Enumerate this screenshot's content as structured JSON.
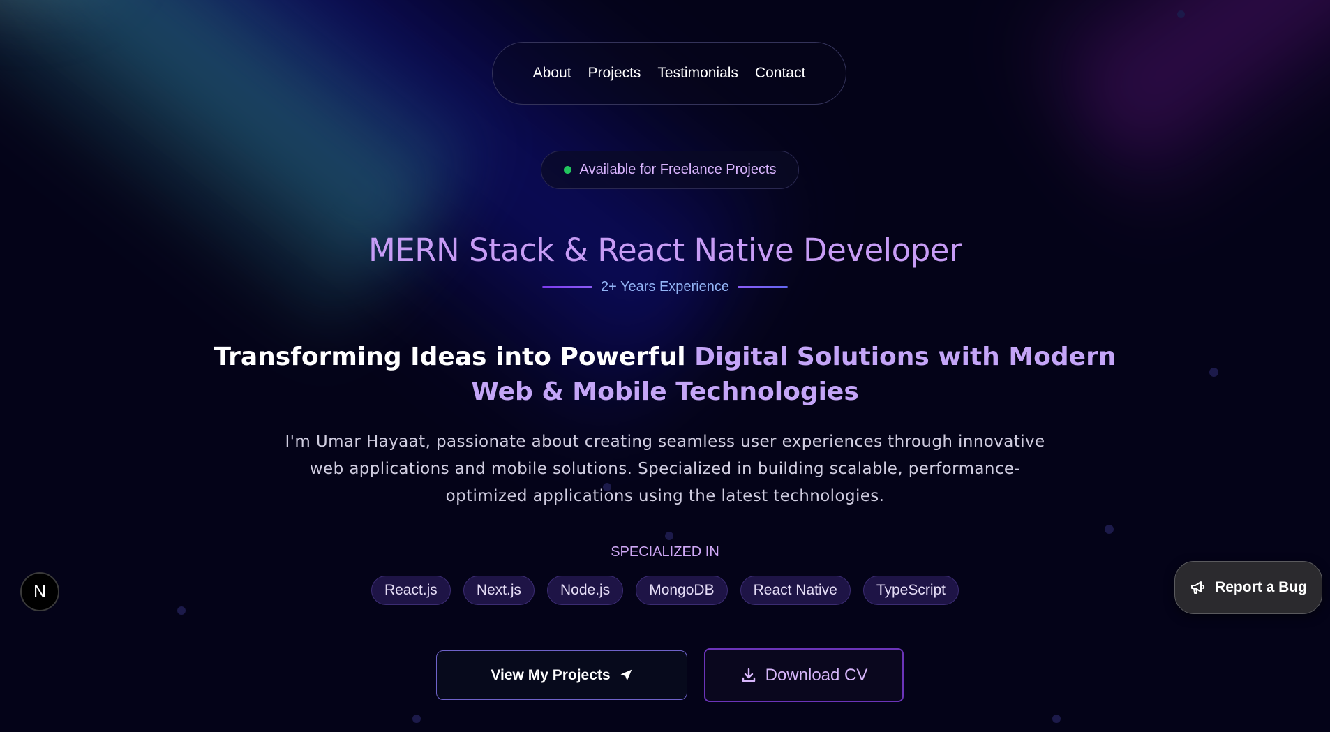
{
  "nav": {
    "items": [
      "About",
      "Projects",
      "Testimonials",
      "Contact"
    ]
  },
  "badge": {
    "text": "Available for Freelance Projects",
    "status_color": "#22c55e"
  },
  "hero": {
    "title": "MERN Stack & React Native Developer",
    "experience": "2+ Years Experience",
    "headline_white": "Transforming Ideas into Powerful ",
    "headline_purple": "Digital Solutions with Modern Web & Mobile Technologies",
    "description": "I'm Umar Hayaat, passionate about creating seamless user experiences through innovative web applications and mobile solutions. Specialized in building scalable, performance-optimized applications using the latest technologies."
  },
  "specialized": {
    "label": "SPECIALIZED IN",
    "skills": [
      "React.js",
      "Next.js",
      "Node.js",
      "MongoDB",
      "React Native",
      "TypeScript"
    ]
  },
  "actions": {
    "projects_label": "View My Projects",
    "projects_icon": "send-icon",
    "cv_label": "Download CV",
    "cv_icon": "download-icon"
  },
  "widgets": {
    "bug_label": "Report a Bug",
    "bug_icon": "megaphone-icon",
    "dev_badge": "N"
  },
  "colors": {
    "accent_purple": "#c79cf5",
    "experience_blue": "#93b4f5",
    "background": "#040318"
  }
}
